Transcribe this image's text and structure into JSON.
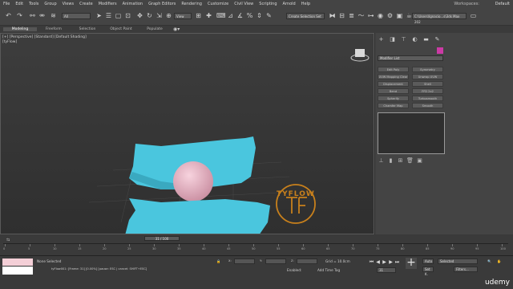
{
  "menu": {
    "items": [
      "File",
      "Edit",
      "Tools",
      "Group",
      "Views",
      "Create",
      "Modifiers",
      "Animation",
      "Graph Editors",
      "Rendering",
      "Customize",
      "Civil View",
      "Scripting",
      "Arnold",
      "Help"
    ],
    "workspaces_label": "Workspaces:",
    "workspaces_value": "Default"
  },
  "toolbar": {
    "selection_filter": "All",
    "view_dropdown": "View",
    "named_selection": "Create Selection Set",
    "project_path": "C:\\Users\\Ignacio...s\\3ds Max 202"
  },
  "ribbon": {
    "tabs": [
      "Modeling",
      "Freeform",
      "Selection",
      "Object Paint",
      "Populate"
    ]
  },
  "viewport": {
    "label": "[+] [Perspective] [Standard] [Default Shading]",
    "sublabel": "[tyFlow]",
    "logo_text": "TYFLOW"
  },
  "command_panel": {
    "modifier_list": "Modifier List",
    "buttons": [
      "Edit Poly",
      "Symmetry",
      "UVW Mapping Clear",
      "Unwrap UVW",
      "Displacement",
      "Shell",
      "Bend",
      "FFD 2x2",
      "Spherify",
      "Turbosmooth",
      "Chamfer Map",
      "Smooth"
    ]
  },
  "timeline": {
    "slider_label": "31 / 100",
    "ticks": [
      "0",
      "5",
      "10",
      "15",
      "20",
      "25",
      "30",
      "35",
      "40",
      "45",
      "50",
      "55",
      "60",
      "65",
      "70",
      "75",
      "80",
      "85",
      "90",
      "95",
      "100"
    ]
  },
  "status": {
    "none_selected": "None Selected",
    "prompt": "tyFlow001: [Frame: 31] [0.00%] [pause: ESC | cancel: SHIFT+ESC]",
    "grid": "Grid = 10.0cm",
    "enabled": "Enabled:",
    "add_time_tag": "Add Time Tag",
    "auto_label": "Auto",
    "set_key": "Set K.",
    "selected": "Selected",
    "filters": "Filters...",
    "frame": "31"
  },
  "watermark": "udemy",
  "colors": {
    "cloth": "#4ac6de",
    "sphere": "#efb7c8",
    "logo": "#c8801c",
    "swatch": "#cc3aa5"
  }
}
